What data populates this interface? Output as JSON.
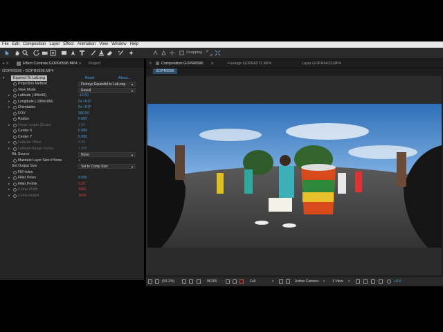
{
  "menu": [
    "File",
    "Edit",
    "Composition",
    "Layer",
    "Effect",
    "Animation",
    "View",
    "Window",
    "Help"
  ],
  "toolbar": {
    "snapping_label": "Snapping"
  },
  "left_panel": {
    "tab_effect_controls": "Effect Controls GOPR6596.MP4",
    "tab_project": "Project",
    "layer_path": "GOPR6596 • GOPR6596.MP4",
    "effect": {
      "index": "fx",
      "name": "Equirect To LatLong",
      "reset": "Reset",
      "about": "About..."
    },
    "params": [
      {
        "label": "Projection Method",
        "value": "Fisheye Equisolid to LatLong",
        "type": "dropdown"
      },
      {
        "label": "View Mode",
        "value": "Result",
        "type": "dropdown"
      },
      {
        "label": "Latitude (-90to90)",
        "value": "-10.00",
        "type": "value"
      },
      {
        "label": "Longitude (-180to180)",
        "value": "0x +0.0°",
        "type": "value"
      },
      {
        "label": "Orientation",
        "value": "0x +0.0°",
        "type": "value"
      },
      {
        "label": "FOV",
        "value": "280.00",
        "type": "value"
      },
      {
        "label": "Radius",
        "value": "0.500",
        "type": "value"
      },
      {
        "label": "Focal Length (Scale)",
        "value": "1.00",
        "type": "value",
        "dim": true
      },
      {
        "label": "Center X",
        "value": "0.500",
        "type": "value"
      },
      {
        "label": "Center Y",
        "value": "0.500",
        "type": "value"
      },
      {
        "label": "Latitude Offset",
        "value": "0.00",
        "type": "value",
        "dim": true
      },
      {
        "label": "Latitude Range Factor",
        "value": "1.000",
        "type": "value",
        "dim": true
      },
      {
        "label": "Alt. Source",
        "value": "None",
        "type": "dropdown",
        "indent": true
      },
      {
        "label": "Maintain Layer Size if None",
        "value": "✓",
        "type": "check"
      },
      {
        "label": "Set Output Size",
        "value": "Set to Comp Size",
        "type": "dropdown",
        "indent": true
      },
      {
        "label": "Fill Holes",
        "value": "",
        "type": "check"
      },
      {
        "label": "Filter Poles",
        "value": "0.500",
        "type": "value"
      },
      {
        "label": "Filter Profile",
        "value": "0.25",
        "type": "value",
        "red": true
      },
      {
        "label": "Comp Width",
        "value": "3000",
        "type": "value",
        "dim": true,
        "red": true
      },
      {
        "label": "Comp Height",
        "value": "1500",
        "type": "value",
        "dim": true,
        "red": true
      }
    ]
  },
  "right_panel": {
    "tab_composition": "Composition GOPR6596",
    "tab_footage": "Footage GOPR6571.MP4",
    "tab_layer": "Layer GOPR6433.MP4",
    "comp_chip": "GOPR6596",
    "viewer_bar": {
      "zoom": "(53.2%)",
      "timecode": "06265",
      "resolution": "Full",
      "camera": "Active Camera",
      "view": "1 View",
      "exposure": "+0.0"
    }
  }
}
